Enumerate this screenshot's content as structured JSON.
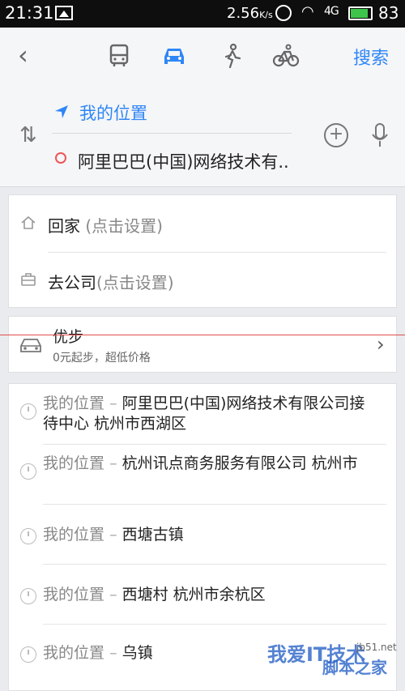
{
  "status_bar": {
    "time": "21:31",
    "speed": "2.56",
    "speed_unit": "K/s",
    "signal": "4G",
    "battery": "83",
    "battery_color": "#3cc54a"
  },
  "nav": {
    "search_label": "搜索",
    "modes": [
      "bus-icon",
      "car-icon",
      "walk-icon",
      "bike-icon"
    ],
    "active_mode": "car-icon",
    "accent_color": "#2f86f6"
  },
  "route": {
    "from": "我的位置",
    "to": "阿里巴巴(中国)网络技术有.."
  },
  "shortcuts": [
    {
      "label": "回家",
      "hint": "(点击设置)"
    },
    {
      "label": "去公司",
      "hint": "(点击设置)"
    }
  ],
  "promo": {
    "title": "优步",
    "subtitle": "0元起步，超低价格"
  },
  "history": [
    {
      "from": "我的位置",
      "sep": "–",
      "dest": "阿里巴巴(中国)网络技术有限公司接待中心 杭州市西湖区"
    },
    {
      "from": "我的位置",
      "sep": "–",
      "dest": "杭州讯点商务服务有限公司 杭州市"
    },
    {
      "from": "我的位置",
      "sep": "–",
      "dest": "西塘古镇"
    },
    {
      "from": "我的位置",
      "sep": "–",
      "dest": "西塘村 杭州市余杭区"
    },
    {
      "from": "我的位置",
      "sep": "–",
      "dest": "乌镇"
    }
  ],
  "watermark": {
    "line1": "我爱IT技术",
    "line2": "脚本之家",
    "url": "jb51.net"
  }
}
